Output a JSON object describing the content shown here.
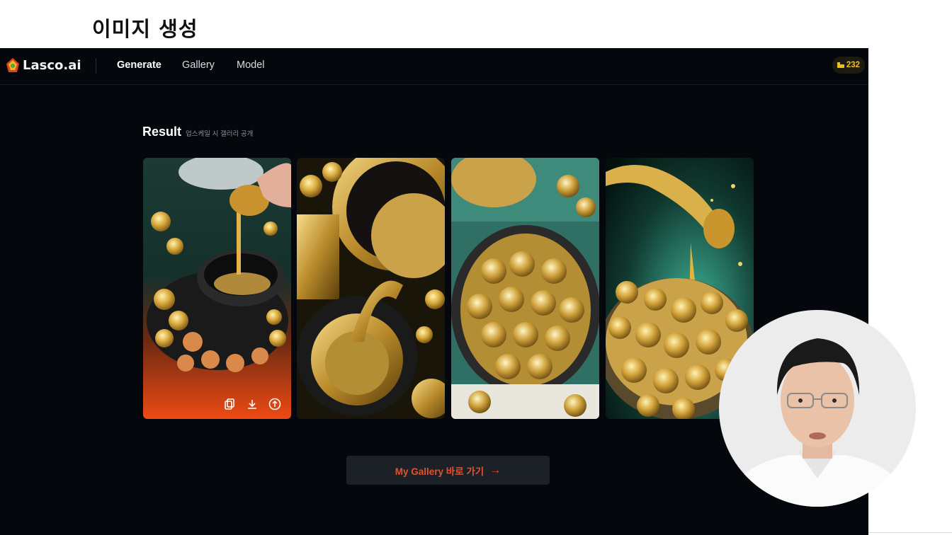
{
  "slide": {
    "title": "이미지 생성"
  },
  "app": {
    "brand": "Lasco.ai",
    "nav": [
      {
        "label": "Generate",
        "active": true
      },
      {
        "label": "Gallery",
        "active": false
      },
      {
        "label": "Model",
        "active": false
      }
    ],
    "credits": "232"
  },
  "result": {
    "title": "Result",
    "subtitle": "업스케일 시 갤러리 공개",
    "images": [
      {
        "subject": "gold coins poured into pot, orange gradient"
      },
      {
        "subject": "golden pots with coins"
      },
      {
        "subject": "pot full of gold coins, teal background"
      },
      {
        "subject": "gold splashing into bowl of coins"
      }
    ],
    "actions": [
      "copy-icon",
      "download-icon",
      "upscale-icon"
    ]
  },
  "cta": {
    "label": "My Gallery 바로 가기",
    "arrow": "→"
  },
  "colors": {
    "background": "#04080c",
    "accent": "#e8502a",
    "credit": "#f0c01c"
  }
}
